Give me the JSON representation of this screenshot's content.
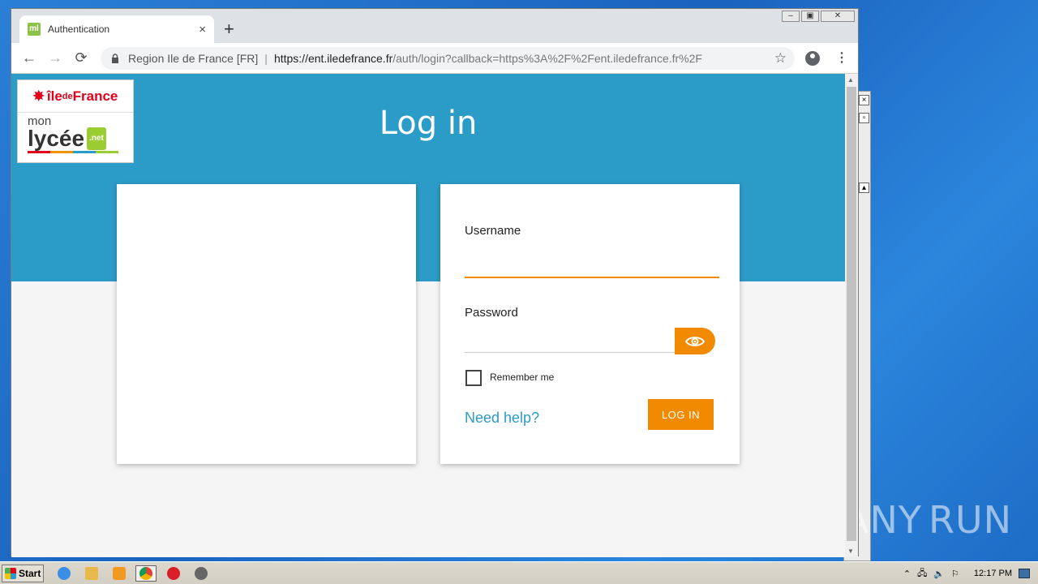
{
  "browser": {
    "tab_title": "Authentication",
    "tab_close": "×",
    "new_tab": "+",
    "site_name": "Region Ile de France [FR]",
    "separator": "|",
    "url_host": "https://ent.iledefrance.fr",
    "url_path": "/auth/login?callback=https%3A%2F%2Fent.iledefrance.fr%2F",
    "back": "←",
    "forward": "→",
    "reload": "⟳",
    "star": "☆",
    "menu": "⋮",
    "favicon": "ml"
  },
  "logo": {
    "top_prefix": "île",
    "top_de": "de",
    "top_suffix": "France",
    "mon": "mon",
    "lycee": "lycée",
    "net": ".net"
  },
  "page": {
    "title": "Log in"
  },
  "login": {
    "username_label": "Username",
    "username_value": "",
    "password_label": "Password",
    "password_value": "",
    "remember_label": "Remember me",
    "help_link": "Need help?",
    "login_button": "LOG IN"
  },
  "taskbar": {
    "start_label": "Start",
    "clock": "12:17 PM"
  },
  "watermark": {
    "left": "ANY",
    "right": "RUN"
  },
  "colors": {
    "accent": "#f28a00",
    "hero": "#2b9cc8",
    "link": "#2b9cc8"
  },
  "icons": [
    "lock-icon",
    "star-icon",
    "account-icon",
    "menu-icon",
    "eye-icon",
    "checkbox-icon"
  ]
}
